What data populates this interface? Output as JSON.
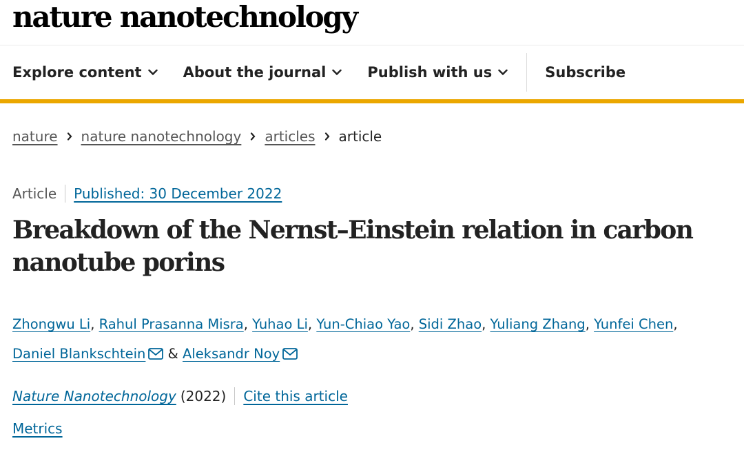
{
  "brand": {
    "logo_text": "nature nanotechnology"
  },
  "nav": {
    "items": [
      {
        "label": "Explore content",
        "has_dropdown": true
      },
      {
        "label": "About the journal",
        "has_dropdown": true
      },
      {
        "label": "Publish with us",
        "has_dropdown": true
      }
    ],
    "subscribe_label": "Subscribe"
  },
  "breadcrumb": {
    "items": [
      "nature",
      "nature nanotechnology",
      "articles"
    ],
    "current": "article"
  },
  "article": {
    "type": "Article",
    "published": "Published: 30 December 2022",
    "title": "Breakdown of the Nernst–Einstein relation in carbon nanotube porins",
    "authors": [
      "Zhongwu Li",
      "Rahul Prasanna Misra",
      "Yuhao Li",
      "Yun-Chiao Yao",
      "Sidi Zhao",
      "Yuliang Zhang",
      "Yunfei Chen",
      "Daniel Blankschtein",
      "Aleksandr Noy"
    ],
    "author_separator": ", ",
    "author_joiner": " & ",
    "journal": "Nature Nanotechnology",
    "year": "(2022)",
    "cite_label": "Cite this article",
    "metrics_label": "Metrics"
  },
  "colors": {
    "accent_bar": "#eba700",
    "link": "#006699",
    "text": "#222222"
  },
  "icons": {
    "dropdown": "chevron-down-icon",
    "breadcrumb_separator": "chevron-right-icon",
    "corresponding_author": "envelope-icon"
  }
}
